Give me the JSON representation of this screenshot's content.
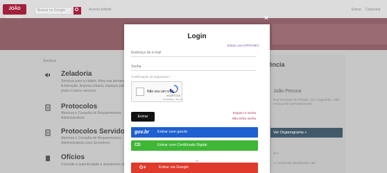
{
  "topbar": {
    "logo_text": "JOÃO PESSOA",
    "search_placeholder": "Buscar no Google",
    "link_access": "Acesso Infantil",
    "link_enter": "Entrar",
    "link_register": "Cadastrar"
  },
  "page": {
    "section_label": "Serviços",
    "services": [
      {
        "title": "Zeladoria",
        "desc": "Serviços para a cidade. Abra sua demanda de iluminação, limpeza urbana, espaços públicos, poda e outros serviços."
      },
      {
        "title": "Protocolos",
        "desc": "Abertura e Consulta de Requerimentos Administrativos"
      },
      {
        "title": "Protocolos Servidores",
        "desc": "Abertura e Consulta de Requerimentos Administrativos para Servidores"
      },
      {
        "title": "Ofícios",
        "desc": "Consulte a autenticidade e andamento de ofícios"
      }
    ],
    "right_title": "rência",
    "right_sub": "João Pessoa",
    "right_addr": "Rua Visconde de Pelotas, 1177 Jaguaribe, João Pessoa PB CEP 58015-000",
    "right_button": "Ver Organograma »",
    "right_small_1": "ão?",
    "right_small_2": "or Central de atendimento 156"
  },
  "modal": {
    "close": "×",
    "title": "Login",
    "top_link": "Entrar com CPF/CNPJ",
    "email_placeholder": "Endereço de e-mail",
    "password_placeholder": "Senha",
    "security_note": "Confirmação de segurança *",
    "captcha_label": "Não sou um robô",
    "captcha_brand": "reCAPTCHA",
    "captcha_privacy": "Privacidade - Termos",
    "enter_button": "Entrar",
    "forgot_password": "Esqueci a senha",
    "no_account": "Não tenho senha",
    "govbr_icon": "gov.br",
    "govbr_label": "Entrar com gov.br",
    "cert_icon": "CD",
    "cert_label": "Entrar com Certificado Digital",
    "or_text": "ou",
    "google_icon": "G+",
    "google_label": "Entrar via Google"
  },
  "colors": {
    "brand": "#a3203c",
    "govbr": "#1f5fcf",
    "certificate": "#3fb636",
    "google": "#e03a2c"
  }
}
